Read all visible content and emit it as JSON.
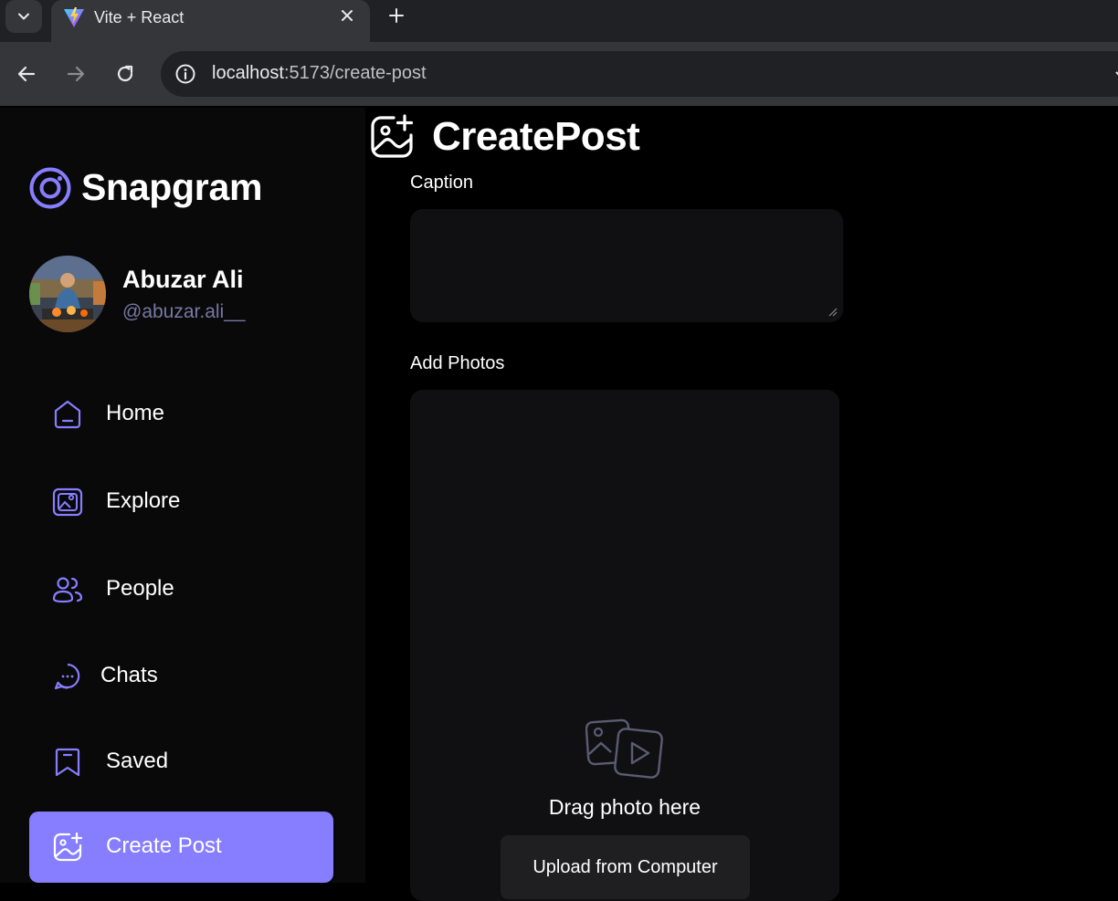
{
  "browser": {
    "tab_title": "Vite + React",
    "url_host": "localhost",
    "url_path": ":5173/create-post"
  },
  "app": {
    "brand": "Snapgram",
    "accent_color": "#877eff",
    "user": {
      "name": "Abuzar Ali",
      "handle": "@abuzar.ali__"
    },
    "nav": [
      {
        "label": "Home",
        "icon": "home-icon"
      },
      {
        "label": "Explore",
        "icon": "wallpaper-icon"
      },
      {
        "label": "People",
        "icon": "people-icon"
      },
      {
        "label": "Chats",
        "icon": "chat-icon"
      },
      {
        "label": "Saved",
        "icon": "bookmark-icon"
      },
      {
        "label": "Create Post",
        "icon": "gallery-add-icon",
        "active": true
      }
    ]
  },
  "page": {
    "title": "CreatePost",
    "caption_label": "Caption",
    "caption_value": "",
    "photos_label": "Add Photos",
    "drop_text": "Drag photo here",
    "upload_button": "Upload from Computer"
  }
}
